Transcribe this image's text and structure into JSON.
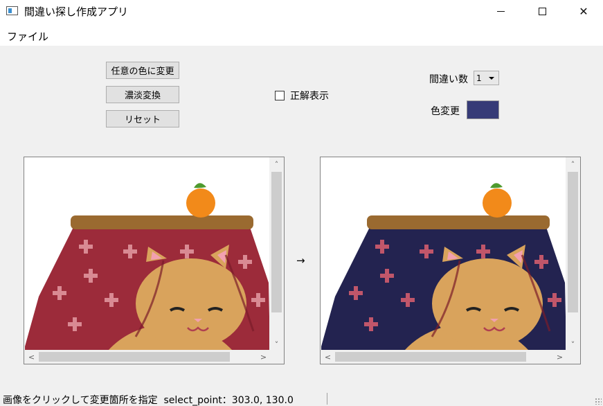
{
  "window": {
    "title": "間違い探し作成アプリ",
    "close_glyph": "✕"
  },
  "menu": {
    "file_label": "ファイル"
  },
  "controls": {
    "btn_any_color": "任意の色に変更",
    "btn_shade": "濃淡変換",
    "btn_reset": "リセット",
    "show_answer_label": "正解表示",
    "show_answer_checked": false,
    "diff_count_label": "間違い数",
    "diff_count_value": "1",
    "color_change_label": "色変更",
    "selected_color": "#363b77"
  },
  "arrow": "→",
  "colors": {
    "left_cloth": "#9c2b3a",
    "right_cloth": "#232350",
    "table_top": "#9a6a30",
    "cat_body": "#d9a35c",
    "orange": "#f28a1a"
  },
  "scroll_glyphs": {
    "up": "˄",
    "down": "˅",
    "left": "<",
    "right": ">"
  },
  "status": {
    "message": "画像をクリックして変更箇所を指定",
    "select_point": "select_point：303.0, 130.0"
  }
}
